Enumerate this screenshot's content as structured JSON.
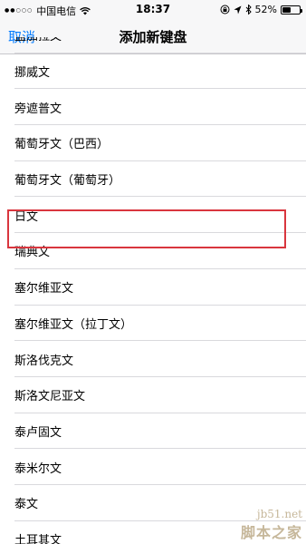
{
  "status": {
    "carrier": "中国电信",
    "time": "18:37",
    "battery": "52%",
    "battery_level": 0.52,
    "icons": [
      "signal-dots-icon",
      "wifi-icon",
      "rotation-lock-icon",
      "location-arrow-icon",
      "bluetooth-icon",
      "battery-icon"
    ]
  },
  "nav": {
    "cancel": "取消",
    "title": "添加新键盘"
  },
  "list": {
    "items": [
      "孟加拉文",
      "挪威文",
      "旁遮普文",
      "葡萄牙文（巴西）",
      "葡萄牙文（葡萄牙）",
      "日文",
      "瑞典文",
      "塞尔维亚文",
      "塞尔维亚文（拉丁文）",
      "斯洛伐克文",
      "斯洛文尼亚文",
      "泰卢固文",
      "泰米尔文",
      "泰文",
      "土耳其文"
    ],
    "highlighted_item": "日文",
    "highlight_color": "#d9363e"
  },
  "watermark": {
    "url": "jb51.net",
    "name": "脚本之家"
  },
  "colors": {
    "accent": "#007aff",
    "bar_background": "#f7f7f8"
  }
}
